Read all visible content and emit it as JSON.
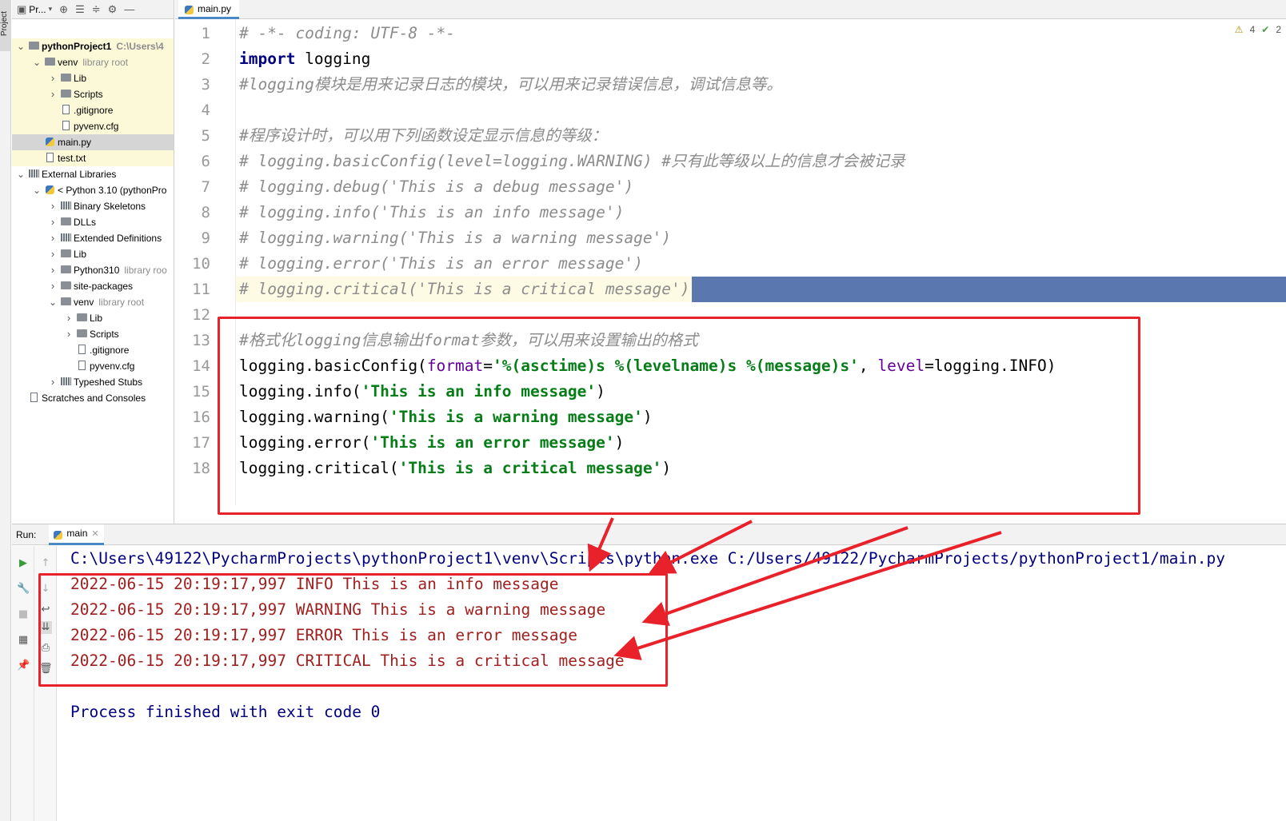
{
  "left_strip": {
    "label": "Project"
  },
  "project_panel": {
    "toolbar_title": "Pr...",
    "tree": [
      {
        "label": "pythonProject1",
        "hint": "C:\\Users\\4",
        "level": 0,
        "kind": "folder",
        "expanded": true,
        "bold": true
      },
      {
        "label": "venv",
        "hint": "library root",
        "level": 1,
        "kind": "folder",
        "expanded": true
      },
      {
        "label": "Lib",
        "level": 2,
        "kind": "folder",
        "expanded": false
      },
      {
        "label": "Scripts",
        "level": 2,
        "kind": "folder",
        "expanded": false
      },
      {
        "label": ".gitignore",
        "level": 2,
        "kind": "file"
      },
      {
        "label": "pyvenv.cfg",
        "level": 2,
        "kind": "file"
      },
      {
        "label": "main.py",
        "level": 1,
        "kind": "py",
        "selected": true
      },
      {
        "label": "test.txt",
        "level": 1,
        "kind": "file"
      },
      {
        "label": "External Libraries",
        "level": 0,
        "kind": "lib",
        "expanded": true
      },
      {
        "label": "< Python 3.10 (pythonPro",
        "level": 1,
        "kind": "py",
        "expanded": true
      },
      {
        "label": "Binary Skeletons",
        "level": 2,
        "kind": "lib",
        "expanded": false
      },
      {
        "label": "DLLs",
        "level": 2,
        "kind": "folder",
        "expanded": false
      },
      {
        "label": "Extended Definitions",
        "level": 2,
        "kind": "lib",
        "expanded": false
      },
      {
        "label": "Lib",
        "level": 2,
        "kind": "folder",
        "expanded": false
      },
      {
        "label": "Python310",
        "hint": "library roo",
        "level": 2,
        "kind": "folder",
        "expanded": false
      },
      {
        "label": "site-packages",
        "level": 2,
        "kind": "folder",
        "expanded": false
      },
      {
        "label": "venv",
        "hint": "library root",
        "level": 2,
        "kind": "folder",
        "expanded": true
      },
      {
        "label": "Lib",
        "level": 3,
        "kind": "folder",
        "expanded": false
      },
      {
        "label": "Scripts",
        "level": 3,
        "kind": "folder",
        "expanded": false
      },
      {
        "label": ".gitignore",
        "level": 3,
        "kind": "file"
      },
      {
        "label": "pyvenv.cfg",
        "level": 3,
        "kind": "file"
      },
      {
        "label": "Typeshed Stubs",
        "level": 2,
        "kind": "lib",
        "expanded": false
      },
      {
        "label": "Scratches and Consoles",
        "level": 0,
        "kind": "scratch"
      }
    ]
  },
  "editor": {
    "tab_label": "main.py",
    "inspections": {
      "warnings": "4",
      "weak": "2"
    },
    "lines": [
      {
        "n": "1",
        "parts": [
          {
            "t": "# -*- coding: UTF-8 -*-",
            "c": "comment"
          }
        ]
      },
      {
        "n": "2",
        "parts": [
          {
            "t": "import",
            "c": "kw"
          },
          {
            "t": " logging",
            "c": ""
          }
        ]
      },
      {
        "n": "3",
        "parts": [
          {
            "t": "#logging模块是用来记录日志的模块，可以用来记录错误信息，调试信息等。",
            "c": "comment"
          }
        ]
      },
      {
        "n": "4",
        "parts": []
      },
      {
        "n": "5",
        "parts": [
          {
            "t": "#程序设计时，可以用下列函数设定显示信息的等级：",
            "c": "comment"
          }
        ]
      },
      {
        "n": "6",
        "parts": [
          {
            "t": "# logging.basicConfig(level=logging.WARNING) #只有此等级以上的信息才会被记录",
            "c": "comment"
          }
        ]
      },
      {
        "n": "7",
        "parts": [
          {
            "t": "# logging.debug('This is a debug message')",
            "c": "comment"
          }
        ]
      },
      {
        "n": "8",
        "parts": [
          {
            "t": "# logging.info('This is an info message')",
            "c": "comment"
          }
        ]
      },
      {
        "n": "9",
        "parts": [
          {
            "t": "# logging.warning('This is a warning message')",
            "c": "comment"
          }
        ]
      },
      {
        "n": "10",
        "parts": [
          {
            "t": "# logging.error('This is an error message')",
            "c": "comment"
          }
        ]
      },
      {
        "n": "11",
        "parts": [
          {
            "t": "# logging.critical('This is a critical message')",
            "c": "comment"
          }
        ]
      },
      {
        "n": "12",
        "parts": []
      },
      {
        "n": "13",
        "parts": [
          {
            "t": "#格式化logging信息输出format参数，可以用来设置输出的格式",
            "c": "comment"
          }
        ]
      },
      {
        "n": "14",
        "parts": [
          {
            "t": "logging.basicConfig(",
            "c": ""
          },
          {
            "t": "format",
            "c": "param"
          },
          {
            "t": "=",
            "c": ""
          },
          {
            "t": "'%(asctime)s %(levelname)s %(message)s'",
            "c": "str"
          },
          {
            "t": ", ",
            "c": ""
          },
          {
            "t": "level",
            "c": "param"
          },
          {
            "t": "=logging.INFO)",
            "c": ""
          }
        ]
      },
      {
        "n": "15",
        "parts": [
          {
            "t": "logging.info(",
            "c": ""
          },
          {
            "t": "'This is an info message'",
            "c": "str"
          },
          {
            "t": ")",
            "c": ""
          }
        ]
      },
      {
        "n": "16",
        "parts": [
          {
            "t": "logging.warning(",
            "c": ""
          },
          {
            "t": "'This is a warning message'",
            "c": "str"
          },
          {
            "t": ")",
            "c": ""
          }
        ]
      },
      {
        "n": "17",
        "parts": [
          {
            "t": "logging.error(",
            "c": ""
          },
          {
            "t": "'This is an error message'",
            "c": "str"
          },
          {
            "t": ")",
            "c": ""
          }
        ]
      },
      {
        "n": "18",
        "parts": [
          {
            "t": "logging.critical(",
            "c": ""
          },
          {
            "t": "'This is a critical message'",
            "c": "str"
          },
          {
            "t": ")",
            "c": ""
          }
        ]
      }
    ]
  },
  "run_panel": {
    "label": "Run:",
    "tab_label": "main",
    "command": "C:\\Users\\49122\\PycharmProjects\\pythonProject1\\venv\\Scripts\\python.exe C:/Users/49122/PycharmProjects/pythonProject1/main.py",
    "output": [
      "2022-06-15 20:19:17,997 INFO This is an info message",
      "2022-06-15 20:19:17,997 WARNING This is a warning message",
      "2022-06-15 20:19:17,997 ERROR This is an error message",
      "2022-06-15 20:19:17,997 CRITICAL This is a critical message"
    ],
    "finished": "Process finished with exit code 0"
  },
  "colors": {
    "comment": "#8c8c8c",
    "keyword": "#000080",
    "string": "#067d17",
    "param": "#660099",
    "stderr": "#a02020",
    "annotation_red": "#e8212a",
    "selection": "#5a77b0"
  }
}
